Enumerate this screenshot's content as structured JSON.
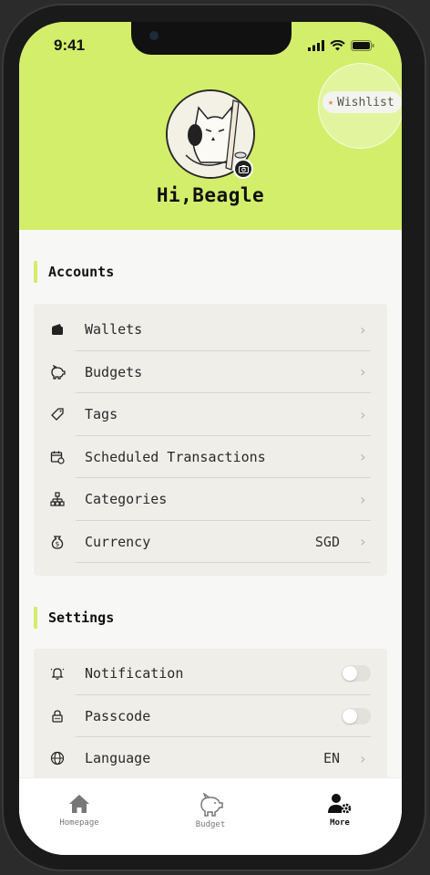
{
  "status_bar": {
    "time": "9:41"
  },
  "profile": {
    "greeting": "Hi,Beagle",
    "wishlist_label": "Wishlist"
  },
  "accounts": {
    "title": "Accounts",
    "items": [
      {
        "icon": "wallet-icon",
        "label": "Wallets",
        "value": ""
      },
      {
        "icon": "piggy-bank-icon",
        "label": "Budgets",
        "value": ""
      },
      {
        "icon": "tag-icon",
        "label": "Tags",
        "value": ""
      },
      {
        "icon": "calendar-repeat-icon",
        "label": "Scheduled Transactions",
        "value": ""
      },
      {
        "icon": "hierarchy-icon",
        "label": "Categories",
        "value": ""
      },
      {
        "icon": "money-bag-icon",
        "label": "Currency",
        "value": "SGD"
      }
    ]
  },
  "settings": {
    "title": "Settings",
    "items": [
      {
        "icon": "bell-icon",
        "label": "Notification",
        "control": "toggle",
        "enabled": false
      },
      {
        "icon": "lock-icon",
        "label": "Passcode",
        "control": "toggle",
        "enabled": false
      },
      {
        "icon": "globe-icon",
        "label": "Language",
        "value": "EN",
        "control": "chevron"
      }
    ]
  },
  "tabbar": {
    "tabs": [
      {
        "icon": "home-icon",
        "label": "Homepage",
        "active": false
      },
      {
        "icon": "piggy-bank-icon",
        "label": "Budget",
        "active": false
      },
      {
        "icon": "user-settings-icon",
        "label": "More",
        "active": true
      }
    ]
  },
  "colors": {
    "accent": "#d3ee6a",
    "card": "#efeee9",
    "background": "#f7f7f5"
  }
}
